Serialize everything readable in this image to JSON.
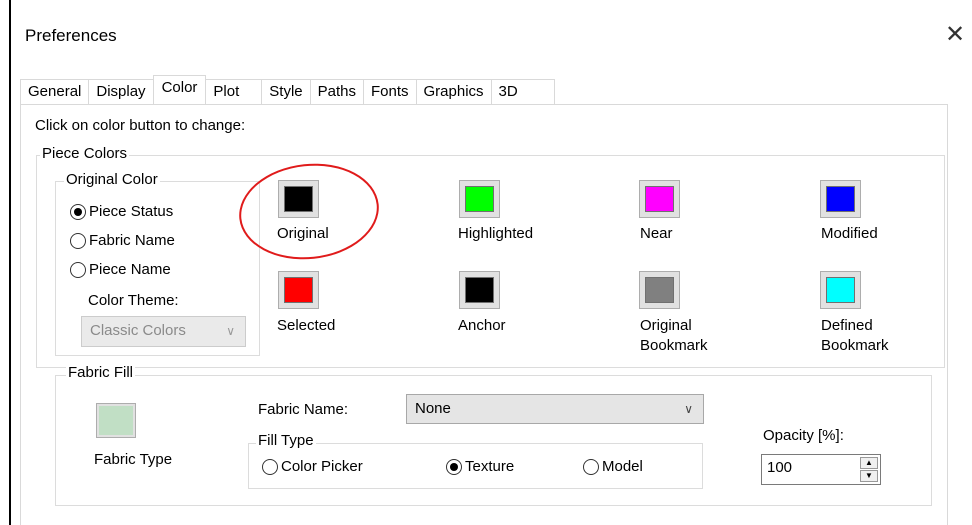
{
  "window": {
    "title": "Preferences",
    "close_glyph": "✕"
  },
  "tabs": [
    {
      "label": "General"
    },
    {
      "label": "Display"
    },
    {
      "label": "Color"
    },
    {
      "label": "Plot"
    },
    {
      "label": "Style"
    },
    {
      "label": "Paths"
    },
    {
      "label": "Fonts"
    },
    {
      "label": "Graphics"
    },
    {
      "label": "3D"
    }
  ],
  "active_tab": "Color",
  "hint": "Click on color button to change:",
  "piece_colors": {
    "legend": "Piece Colors",
    "original_color": {
      "legend": "Original Color",
      "options": [
        {
          "label": "Piece Status",
          "selected": true
        },
        {
          "label": "Fabric Name",
          "selected": false
        },
        {
          "label": "Piece Name",
          "selected": false
        }
      ],
      "theme_label": "Color Theme:",
      "theme_value": "Classic Colors"
    },
    "swatches": [
      {
        "label": "Original",
        "color": "#000000"
      },
      {
        "label": "Highlighted",
        "color": "#00ff00"
      },
      {
        "label": "Near",
        "color": "#ff00ff"
      },
      {
        "label": "Modified",
        "color": "#0000ff"
      },
      {
        "label": "Selected",
        "color": "#ff0000"
      },
      {
        "label": "Anchor",
        "color": "#000000"
      },
      {
        "label": "Original Bookmark",
        "line1": "Original",
        "line2": "Bookmark",
        "color": "#808080"
      },
      {
        "label": "Defined Bookmark",
        "line1": "Defined",
        "line2": "Bookmark",
        "color": "#00ffff"
      }
    ]
  },
  "fabric_fill": {
    "legend": "Fabric Fill",
    "fabric_type_label": "Fabric Type",
    "fabric_type_color": "#c1dfc5",
    "fabric_name_label": "Fabric Name:",
    "fabric_name_value": "None",
    "fill_type": {
      "legend": "Fill Type",
      "options": [
        {
          "label": "Color Picker",
          "selected": false
        },
        {
          "label": "Texture",
          "selected": true
        },
        {
          "label": "Model",
          "selected": false
        }
      ]
    },
    "opacity_label": "Opacity [%]:",
    "opacity_value": "100"
  },
  "annotation_color": "#e01b1b"
}
